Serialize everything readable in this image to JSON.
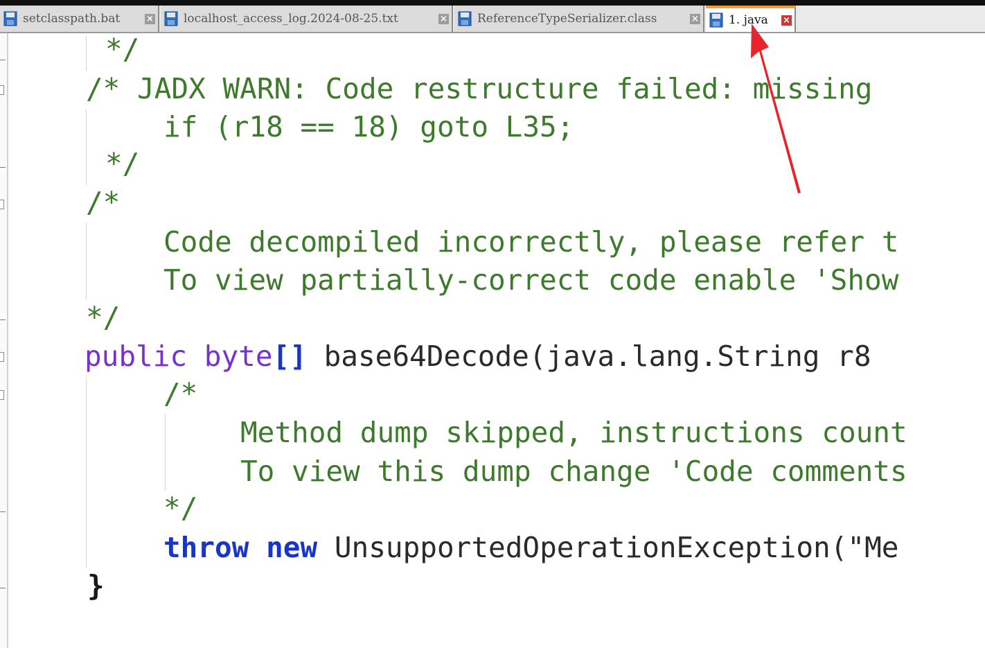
{
  "tabs": [
    {
      "label": "setclasspath.bat",
      "icon": "save-file-icon",
      "active": false
    },
    {
      "label": "localhost_access_log.2024-08-25.txt",
      "icon": "save-file-icon",
      "active": false
    },
    {
      "label": "ReferenceTypeSerializer.class",
      "icon": "save-file-icon",
      "active": false
    },
    {
      "label": "1. java",
      "icon": "save-file-icon",
      "active": true
    }
  ],
  "close_glyph": "×",
  "code_lines": [
    "*/",
    "/* JADX WARN: Code restructure failed: missing",
    "if (r18 == 18) goto L35;",
    "*/",
    "/*",
    "Code decompiled incorrectly, please refer t",
    "To view partially-correct code enable 'Show",
    "*/",
    "public",
    "byte",
    "[]",
    " base64Decode(java.lang.String r8",
    "/*",
    "Method dump skipped, instructions count",
    "To view this dump change 'Code comments",
    "*/",
    "throw",
    "new",
    " UnsupportedOperationException(\"Me",
    "}"
  ],
  "colors": {
    "comment": "#3e7a2c",
    "keyword": "#7a2fd0",
    "keyword_bold": "#1735c8",
    "active_tab_accent": "#f39a3a",
    "annotation_arrow": "#e8242a"
  }
}
